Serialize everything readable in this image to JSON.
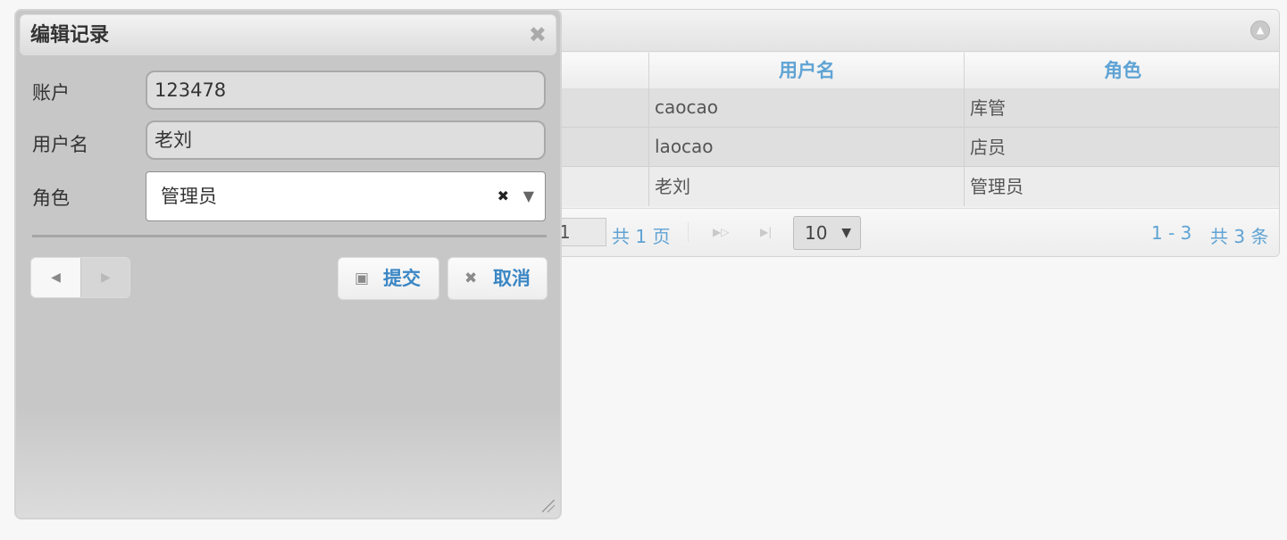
{
  "grid": {
    "columns": [
      "用户名",
      "角色"
    ],
    "rows": [
      {
        "username": "caocao",
        "role": "库管"
      },
      {
        "username": "laocao",
        "role": "店员"
      },
      {
        "username": "老刘",
        "role": "管理员"
      }
    ],
    "pager": {
      "page_input": "1",
      "total_pages_text": "共 1 页",
      "page_size": "10",
      "range_text": "1 - 3",
      "total_records_text": "共 3 条"
    }
  },
  "dialog": {
    "title": "编辑记录",
    "fields": {
      "account": {
        "label": "账户",
        "value": "123478"
      },
      "username": {
        "label": "用户名",
        "value": "老刘"
      },
      "role": {
        "label": "角色",
        "value": "管理员"
      }
    },
    "buttons": {
      "submit": "提交",
      "cancel": "取消"
    }
  },
  "icons": {
    "collapse": "chevron-up-icon",
    "close": "close-icon",
    "save": "save-icon",
    "cancel": "close-icon",
    "prev": "triangle-left-icon",
    "next": "triangle-right-icon",
    "next_page": "next-page-icon",
    "last_page": "last-page-icon"
  },
  "colors": {
    "accent": "#5fa3d4",
    "button_text": "#3a86c4",
    "dialog_bg": "#c7c7c7"
  }
}
